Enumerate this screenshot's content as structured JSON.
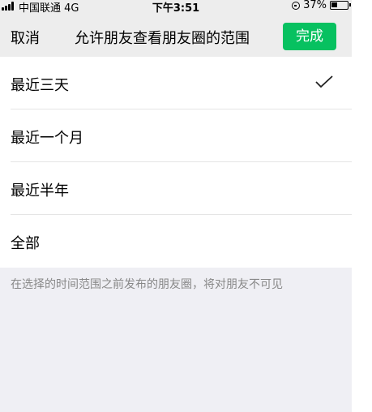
{
  "status_bar": {
    "carrier": "中国联通  4G",
    "time": "下午3:51",
    "battery": "37%",
    "battery_level": 0.37
  },
  "nav": {
    "cancel_label": "取消",
    "title": "允许朋友查看朋友圈的范围",
    "done_label": "完成"
  },
  "options": [
    {
      "label": "最近三天",
      "selected": true
    },
    {
      "label": "最近一个月",
      "selected": false
    },
    {
      "label": "最近半年",
      "selected": false
    },
    {
      "label": "全部",
      "selected": false
    }
  ],
  "footnote": "在选择的时间范围之前发布的朋友圈，将对朋友不可见",
  "colors": {
    "accent": "#07c160",
    "background": "#efeff4",
    "header": "#ededed"
  }
}
